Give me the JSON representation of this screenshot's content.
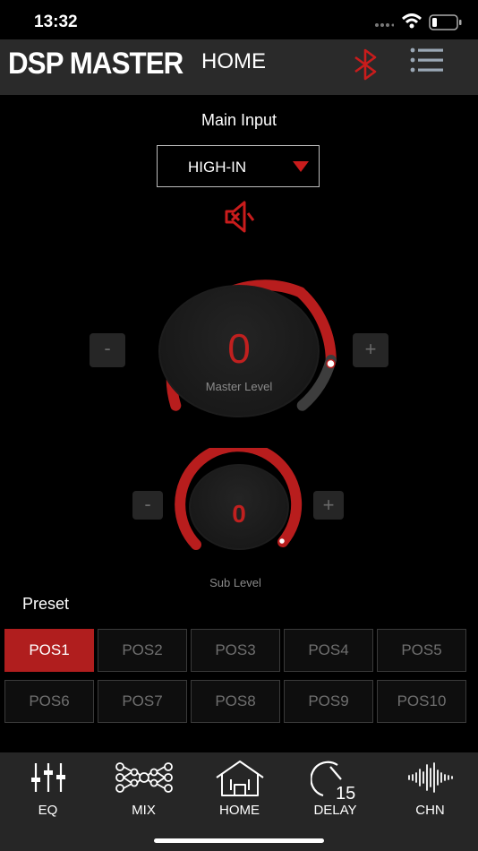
{
  "status_bar": {
    "time": "13:32",
    "icons": [
      "signal-dots-icon",
      "wifi-icon",
      "battery-icon"
    ]
  },
  "header": {
    "brand": "DSP MASTER",
    "title": "HOME",
    "icons": [
      "bluetooth-icon",
      "menu-icon"
    ]
  },
  "main": {
    "input_label": "Main Input",
    "input_select": {
      "value": "HIGH-IN",
      "icon": "dropdown-arrow-icon"
    },
    "mute_icon": "speaker-mute-icon",
    "master": {
      "value": "0",
      "label": "Master Level",
      "minus": "-",
      "plus": "+"
    },
    "sub": {
      "value": "0",
      "label": "Sub Level",
      "minus": "-",
      "plus": "+"
    }
  },
  "preset": {
    "label": "Preset",
    "active": "POS1",
    "buttons": [
      "POS1",
      "POS2",
      "POS3",
      "POS4",
      "POS5",
      "POS6",
      "POS7",
      "POS8",
      "POS9",
      "POS10"
    ]
  },
  "tabs": [
    {
      "label": "EQ",
      "icon": "sliders-icon"
    },
    {
      "label": "MIX",
      "icon": "mix-network-icon"
    },
    {
      "label": "HOME",
      "icon": "home-icon"
    },
    {
      "label": "DELAY",
      "icon": "delay-timer-icon",
      "badge": "15"
    },
    {
      "label": "CHN",
      "icon": "waveform-icon"
    }
  ],
  "colors": {
    "accent": "#c0201f",
    "header_bg": "#2a2a2a",
    "tabbar_bg": "#262626"
  }
}
